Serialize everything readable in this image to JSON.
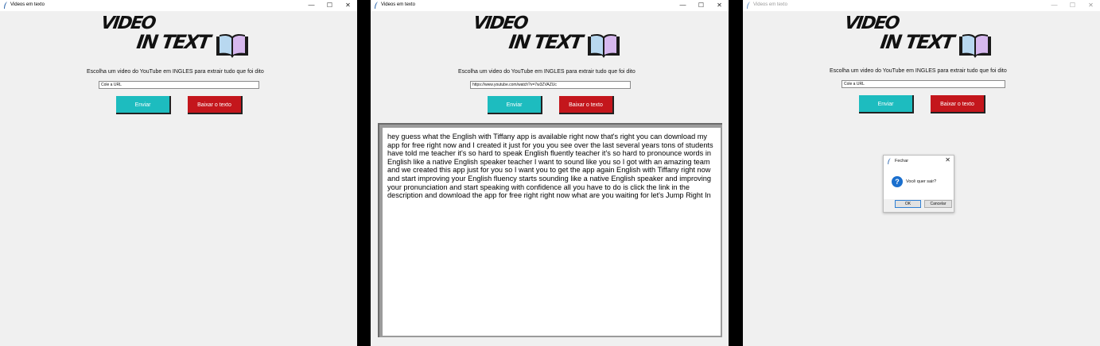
{
  "app": {
    "window_title": "Videos em texto",
    "logo_line1": "VIDEO",
    "logo_line2": "IN TEXT",
    "prompt": "Escolha um video do YouTube em INGLES para extrair tudo que foi dito",
    "send_label": "Enviar",
    "download_label": "Baixar o texto",
    "url_placeholder": "Cole a URL",
    "window_controls": {
      "minimize": "—",
      "maximize": "☐",
      "close": "✕"
    }
  },
  "colors": {
    "send_button": "#1dbcbf",
    "download_button": "#c4161c",
    "window_bg": "#f0f0f0",
    "question_icon": "#1a6fce"
  },
  "icons": [
    "feather-icon",
    "book-icon",
    "question-icon",
    "close-icon"
  ],
  "window1": {
    "url_value": "Cole a URL"
  },
  "window2": {
    "url_value": "https://www.youtube.com/watch?v=7w3ZVAZUc",
    "transcript": "hey guess what the English with Tiffany app is available right now that's right you can download my app for free right now and I created it just for you you see over the last several years tons of students have told me teacher it's so hard to speak English fluently teacher it's so hard to pronounce words in English like a native English speaker teacher I want to sound like you so I got with an amazing team and we created this app just for you so I want you to get the app again English with Tiffany right now and start improving your English fluency starts sounding like a native English speaker and improving your pronunciation and start speaking with confidence all you have to do is click the link in the description and download the app for free right right now what are you waiting for let's Jump Right In"
  },
  "window3": {
    "url_value": "Cole a URL",
    "dialog": {
      "title": "Fechar",
      "message": "Você quer sair?",
      "ok_label": "OK",
      "cancel_label": "Cancelar",
      "close_glyph": "✕",
      "icon_glyph": "?"
    }
  }
}
